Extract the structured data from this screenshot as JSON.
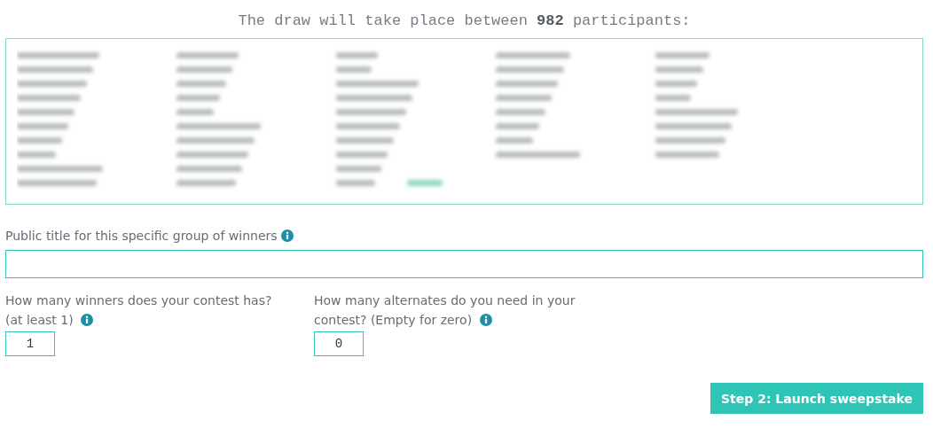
{
  "heading": "The draw will take place between **982** participants:",
  "title_field": {
    "label": "Public title for this specific group of winners"
  },
  "count_fields": [
    {
      "label": "How many winners does your contest has? (at least 1)",
      "value": "1"
    },
    {
      "label": "How many alternates do you need in your contest? (Empty for zero)",
      "value": "0"
    }
  ],
  "submit_button": "Step 2: Launch sweepstake"
}
